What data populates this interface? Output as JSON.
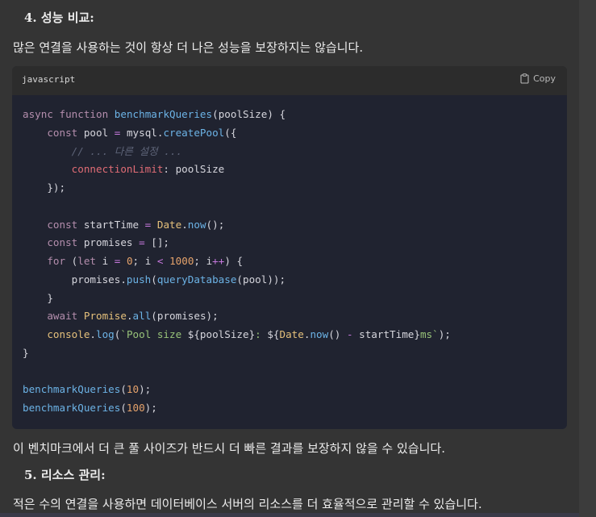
{
  "section4": {
    "heading": "4. 성능 비교:",
    "description": "많은 연결을 사용하는 것이 항상 더 나은 성능을 보장하지는 않습니다."
  },
  "code_block": {
    "language": "javascript",
    "copy_label": "Copy",
    "copy_icon": "clipboard-icon",
    "lines": [
      [
        {
          "t": "async",
          "c": "kw"
        },
        {
          "t": " "
        },
        {
          "t": "function",
          "c": "kw"
        },
        {
          "t": " "
        },
        {
          "t": "benchmarkQueries",
          "c": "fn"
        },
        {
          "t": "(poolSize) {"
        }
      ],
      [
        {
          "t": "    "
        },
        {
          "t": "const",
          "c": "kw"
        },
        {
          "t": " pool "
        },
        {
          "t": "=",
          "c": "op"
        },
        {
          "t": " mysql."
        },
        {
          "t": "createPool",
          "c": "fn"
        },
        {
          "t": "({"
        }
      ],
      [
        {
          "t": "        "
        },
        {
          "t": "// ... 다른 설정 ...",
          "c": "cm"
        }
      ],
      [
        {
          "t": "        "
        },
        {
          "t": "connectionLimit",
          "c": "prop"
        },
        {
          "t": ": poolSize"
        }
      ],
      [
        {
          "t": "    });"
        }
      ],
      [],
      [
        {
          "t": "    "
        },
        {
          "t": "const",
          "c": "kw"
        },
        {
          "t": " startTime "
        },
        {
          "t": "=",
          "c": "op"
        },
        {
          "t": " "
        },
        {
          "t": "Date",
          "c": "cls"
        },
        {
          "t": "."
        },
        {
          "t": "now",
          "c": "fn"
        },
        {
          "t": "();"
        }
      ],
      [
        {
          "t": "    "
        },
        {
          "t": "const",
          "c": "kw"
        },
        {
          "t": " promises "
        },
        {
          "t": "=",
          "c": "op"
        },
        {
          "t": " [];"
        }
      ],
      [
        {
          "t": "    "
        },
        {
          "t": "for",
          "c": "kw"
        },
        {
          "t": " ("
        },
        {
          "t": "let",
          "c": "kw"
        },
        {
          "t": " i "
        },
        {
          "t": "=",
          "c": "op"
        },
        {
          "t": " "
        },
        {
          "t": "0",
          "c": "num"
        },
        {
          "t": "; i "
        },
        {
          "t": "<",
          "c": "op"
        },
        {
          "t": " "
        },
        {
          "t": "1000",
          "c": "num"
        },
        {
          "t": "; i"
        },
        {
          "t": "++",
          "c": "op"
        },
        {
          "t": ") {"
        }
      ],
      [
        {
          "t": "        promises."
        },
        {
          "t": "push",
          "c": "fn"
        },
        {
          "t": "("
        },
        {
          "t": "queryDatabase",
          "c": "fn"
        },
        {
          "t": "(pool));"
        }
      ],
      [
        {
          "t": "    }"
        }
      ],
      [
        {
          "t": "    "
        },
        {
          "t": "await",
          "c": "kw"
        },
        {
          "t": " "
        },
        {
          "t": "Promise",
          "c": "cls"
        },
        {
          "t": "."
        },
        {
          "t": "all",
          "c": "fn"
        },
        {
          "t": "(promises);"
        }
      ],
      [
        {
          "t": "    "
        },
        {
          "t": "console",
          "c": "cls"
        },
        {
          "t": "."
        },
        {
          "t": "log",
          "c": "fn"
        },
        {
          "t": "("
        },
        {
          "t": "`Pool size ",
          "c": "str"
        },
        {
          "t": "${poolSize}"
        },
        {
          "t": ": ",
          "c": "str"
        },
        {
          "t": "${"
        },
        {
          "t": "Date",
          "c": "cls"
        },
        {
          "t": "."
        },
        {
          "t": "now",
          "c": "fn"
        },
        {
          "t": "() "
        },
        {
          "t": "-",
          "c": "op"
        },
        {
          "t": " startTime}"
        },
        {
          "t": "ms`",
          "c": "str"
        },
        {
          "t": ");"
        }
      ],
      [
        {
          "t": "}"
        }
      ],
      [],
      [
        {
          "t": "benchmarkQueries",
          "c": "fn"
        },
        {
          "t": "("
        },
        {
          "t": "10",
          "c": "num"
        },
        {
          "t": ");"
        }
      ],
      [
        {
          "t": "benchmarkQueries",
          "c": "fn"
        },
        {
          "t": "("
        },
        {
          "t": "100",
          "c": "num"
        },
        {
          "t": ");"
        }
      ]
    ]
  },
  "after_code_text": "이 벤치마크에서 더 큰 풀 사이즈가 반드시 더 빠른 결과를 보장하지 않을 수 있습니다.",
  "section5": {
    "heading": "5. 리소스 관리:",
    "description": "적은 수의 연결을 사용하면 데이터베이스 서버의 리소스를 더 효율적으로 관리할 수 있습니다."
  }
}
